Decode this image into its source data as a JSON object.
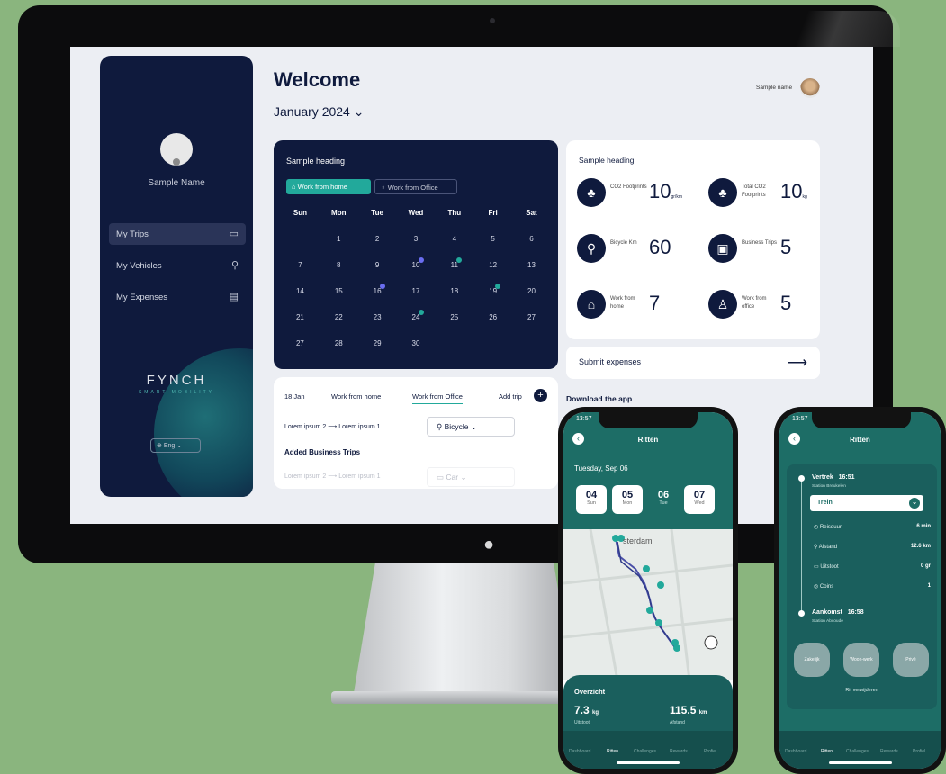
{
  "app": {
    "sidebar": {
      "name": "Sample Name",
      "nav": [
        {
          "label": "My Trips"
        },
        {
          "label": "My Vehicles"
        },
        {
          "label": "My Expenses"
        }
      ],
      "brand": "FYNCH",
      "brand_sub": "SMART MOBILITY",
      "language": "Eng"
    },
    "header": {
      "title": "Welcome",
      "month": "January 2024",
      "user_name": "Sample name"
    },
    "calendar": {
      "heading": "Sample heading",
      "chip_home": "Work from home",
      "chip_office": "Work from Office",
      "weekdays": [
        "Sun",
        "Mon",
        "Tue",
        "Wed",
        "Thu",
        "Fri",
        "Sat"
      ],
      "weeks": [
        [
          "",
          "1",
          "2",
          "3",
          "4",
          "5",
          "6"
        ],
        [
          "7",
          "8",
          "9",
          "10",
          "11",
          "12",
          "13"
        ],
        [
          "14",
          "15",
          "16",
          "17",
          "18",
          "19",
          "20"
        ],
        [
          "21",
          "22",
          "23",
          "24",
          "25",
          "26",
          "27"
        ],
        [
          "27",
          "28",
          "29",
          "30",
          "",
          "",
          ""
        ]
      ]
    },
    "trips": {
      "date": "18 Jan",
      "tab_home": "Work from home",
      "tab_office": "Work from Office",
      "add_trip": "Add trip",
      "row1_from": "Lorem ipsum 2",
      "row1_to": "Lorem ipsum 1",
      "row1_vehicle": "Bicycle",
      "added_title": "Added Business Trips",
      "row2_from": "Lorem ipsum 2",
      "row2_to": "Lorem ipsum 1",
      "row2_vehicle": "Car"
    },
    "stats": {
      "heading": "Sample heading",
      "items": [
        {
          "label": "CO2 Footprints",
          "value": "10",
          "unit": "gr/km"
        },
        {
          "label": "Total CO2 Footprints",
          "value": "10",
          "unit": "kg"
        },
        {
          "label": "Bicycle Km",
          "value": "60",
          "unit": ""
        },
        {
          "label": "Business Trips",
          "value": "5",
          "unit": ""
        },
        {
          "label": "Work from home",
          "value": "7",
          "unit": ""
        },
        {
          "label": "Work from office",
          "value": "5",
          "unit": ""
        }
      ]
    },
    "submit_label": "Submit expenses",
    "download_label": "Download the app"
  },
  "phone_a": {
    "time": "13:57",
    "title": "Ritten",
    "date": "Tuesday, Sep 06",
    "days": [
      {
        "num": "04",
        "name": "Sun"
      },
      {
        "num": "05",
        "name": "Mon"
      },
      {
        "num": "06",
        "name": "Tue"
      },
      {
        "num": "07",
        "name": "Wed"
      }
    ],
    "map_label": "sterdam",
    "overview": {
      "title": "Overzicht",
      "co2": "7.3",
      "co2_unit": "kg",
      "co2_label": "Uitstoot",
      "dist": "115.5",
      "dist_unit": "km",
      "dist_label": "Afstand"
    },
    "tabs": [
      "Dashboard",
      "Ritten",
      "Challenges",
      "Rewards",
      "Profiel"
    ]
  },
  "phone_b": {
    "time": "13:57",
    "title": "Ritten",
    "depart_label": "Vertrek",
    "depart_time": "16:51",
    "depart_station": "Station Breukelen",
    "mode": "Trein",
    "rows": [
      {
        "label": "Reisduur",
        "value": "6 min"
      },
      {
        "label": "Afstand",
        "value": "12.6 km"
      },
      {
        "label": "Uitstoot",
        "value": "0 gr"
      },
      {
        "label": "Coins",
        "value": "1"
      }
    ],
    "arrive_label": "Aankomst",
    "arrive_time": "16:58",
    "arrive_station": "Station Abcoude",
    "purpose": [
      "Zakelijk",
      "Woon-werk",
      "Privé"
    ],
    "delete_label": "Rit verwijderen",
    "tabs": [
      "Dashboard",
      "Ritten",
      "Challenges",
      "Rewards",
      "Profiel"
    ]
  },
  "colors": {
    "navy": "#0f1a3d",
    "teal": "#1d6d66",
    "accent": "#22a99b",
    "background": "#8ab57e"
  }
}
